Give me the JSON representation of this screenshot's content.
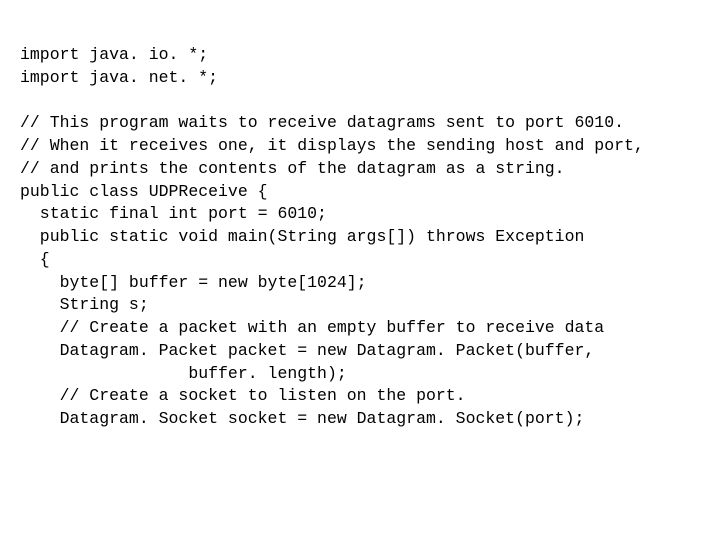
{
  "code": {
    "line1": "import java. io. *;",
    "line2": "import java. net. *;",
    "line3": "",
    "line4": "// This program waits to receive datagrams sent to port 6010.",
    "line5": "// When it receives one, it displays the sending host and port,",
    "line6": "// and prints the contents of the datagram as a string.",
    "line7": "public class UDPReceive {",
    "line8": "  static final int port = 6010;",
    "line9": "  public static void main(String args[]) throws Exception",
    "line10": "  {",
    "line11": "    byte[] buffer = new byte[1024];",
    "line12": "    String s;",
    "line13": "    // Create a packet with an empty buffer to receive data",
    "line14": "    Datagram. Packet packet = new Datagram. Packet(buffer,",
    "line15": "                 buffer. length);",
    "line16": "    // Create a socket to listen on the port.",
    "line17": "    Datagram. Socket socket = new Datagram. Socket(port);"
  }
}
